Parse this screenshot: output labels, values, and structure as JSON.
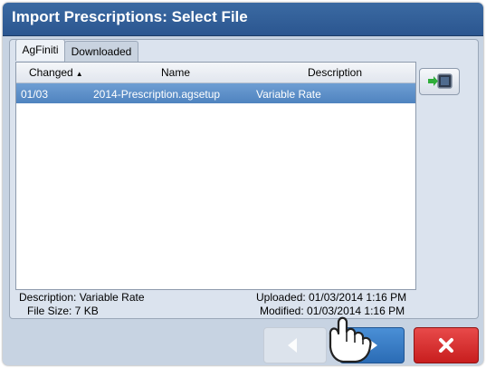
{
  "window": {
    "title": "Import Prescriptions: Select File"
  },
  "tabs": [
    {
      "label": "AgFiniti",
      "active": true
    },
    {
      "label": "Downloaded",
      "active": false
    }
  ],
  "table": {
    "columns": {
      "changed": "Changed",
      "name": "Name",
      "description": "Description"
    },
    "sort_indicator": "ascending",
    "rows": [
      {
        "changed": "01/03",
        "name": "2014-Prescription.agsetup",
        "description": "Variable Rate",
        "selected": true
      }
    ]
  },
  "details": {
    "description": "Description: Variable Rate",
    "file_size": "File Size: 7 KB",
    "uploaded": "Uploaded: 01/03/2014 1:16 PM",
    "modified": "Modified: 01/03/2014 1:16 PM"
  },
  "buttons": {
    "import_side": {
      "icon": "import-arrow-icon"
    },
    "back": {
      "icon": "arrow-left-icon",
      "enabled": false
    },
    "next": {
      "icon": "arrow-right-icon",
      "enabled": true
    },
    "cancel": {
      "icon": "close-x-icon",
      "enabled": true
    }
  },
  "colors": {
    "title_bar": "#2f5c96",
    "selection": "#5b8ecb",
    "next_button": "#2b6cb5",
    "cancel_button": "#d42626"
  }
}
